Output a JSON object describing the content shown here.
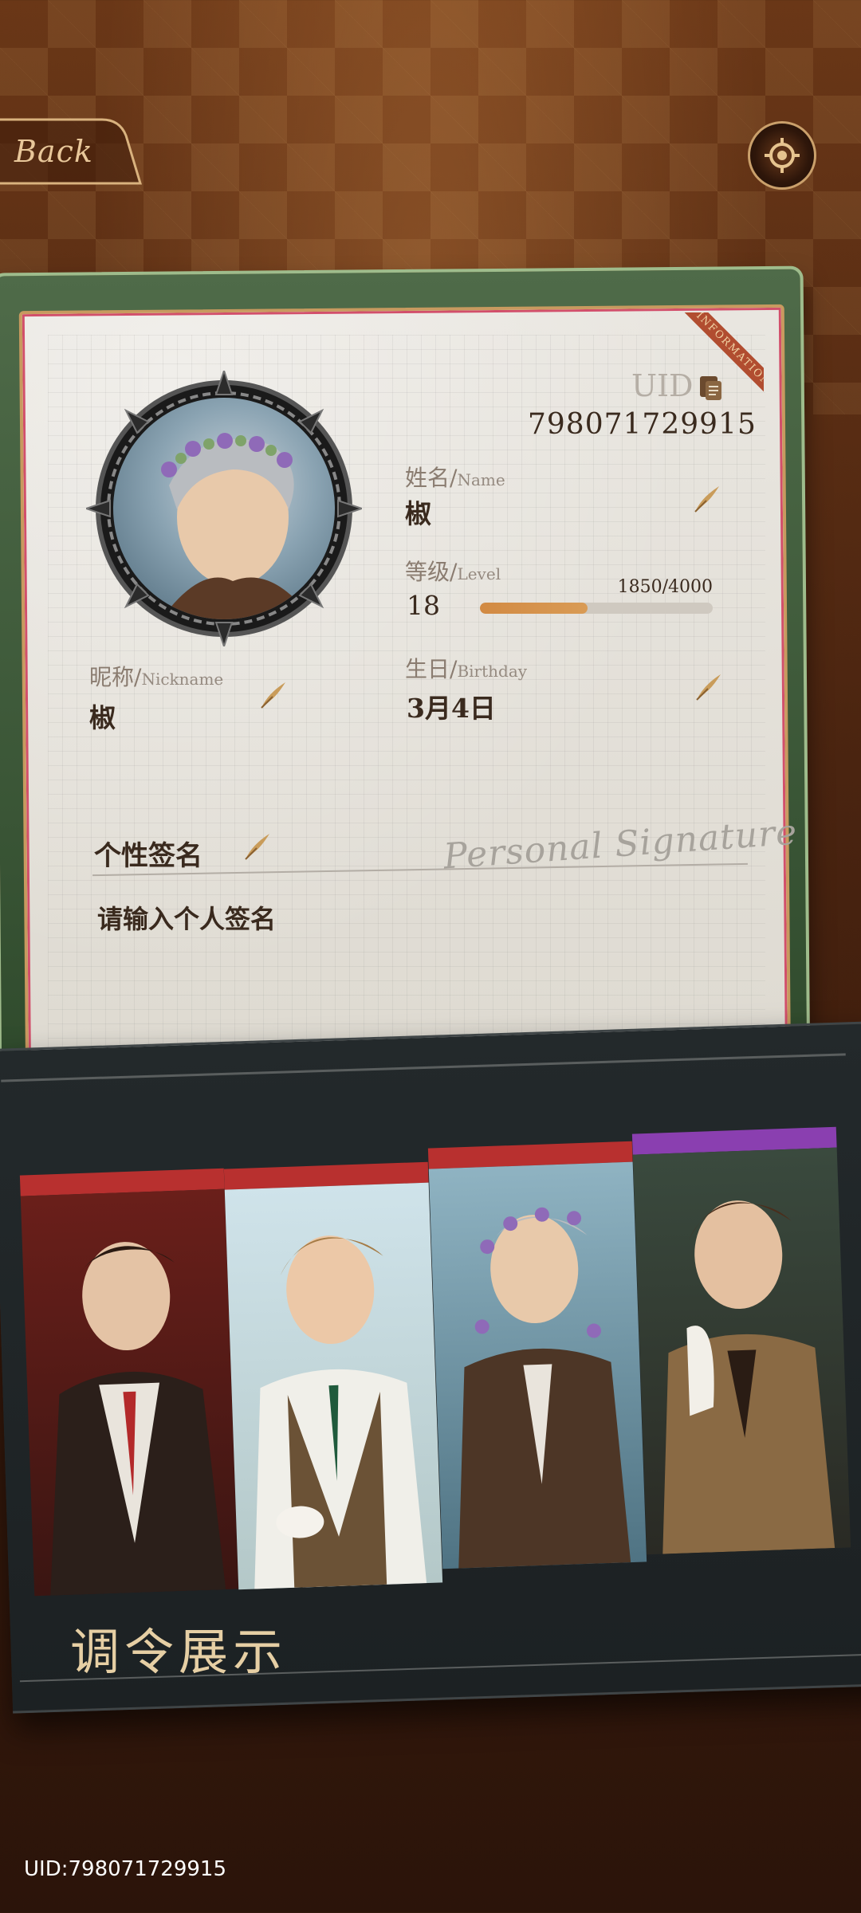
{
  "header": {
    "back_label": "Back"
  },
  "profile": {
    "ribbon_text": "INFORMATION",
    "uid_label": "UID",
    "uid_value": "798071729915",
    "name_label_cn": "姓名/",
    "name_label_en": "Name",
    "name_value": "椒",
    "level_label_cn": "等级/",
    "level_label_en": "Level",
    "level_value": "18",
    "level_progress_text": "1850/4000",
    "level_progress_fraction": 0.4625,
    "nickname_label_cn": "昵称/",
    "nickname_label_en": "Nickname",
    "nickname_value": "椒",
    "birthday_label_cn": "生日/",
    "birthday_label_en": "Birthday",
    "birthday_value": "3月4日",
    "signature_title": "个性签名",
    "signature_script": "Personal Signature",
    "signature_placeholder": "请输入个人签名"
  },
  "showcase": {
    "title": "调令展示",
    "cards": [
      {
        "name": "showcase-card-1",
        "tab_color": "#b8302f"
      },
      {
        "name": "showcase-card-2",
        "tab_color": "#b8302f"
      },
      {
        "name": "showcase-card-3",
        "tab_color": "#b8302f"
      },
      {
        "name": "showcase-card-4",
        "tab_color": "#8a3fb0"
      }
    ]
  },
  "footer": {
    "uid_text": "UID:798071729915"
  },
  "colors": {
    "accent_gold": "#caa06b",
    "text_dark": "#3a2a1e",
    "level_fill": "#d28a43"
  }
}
